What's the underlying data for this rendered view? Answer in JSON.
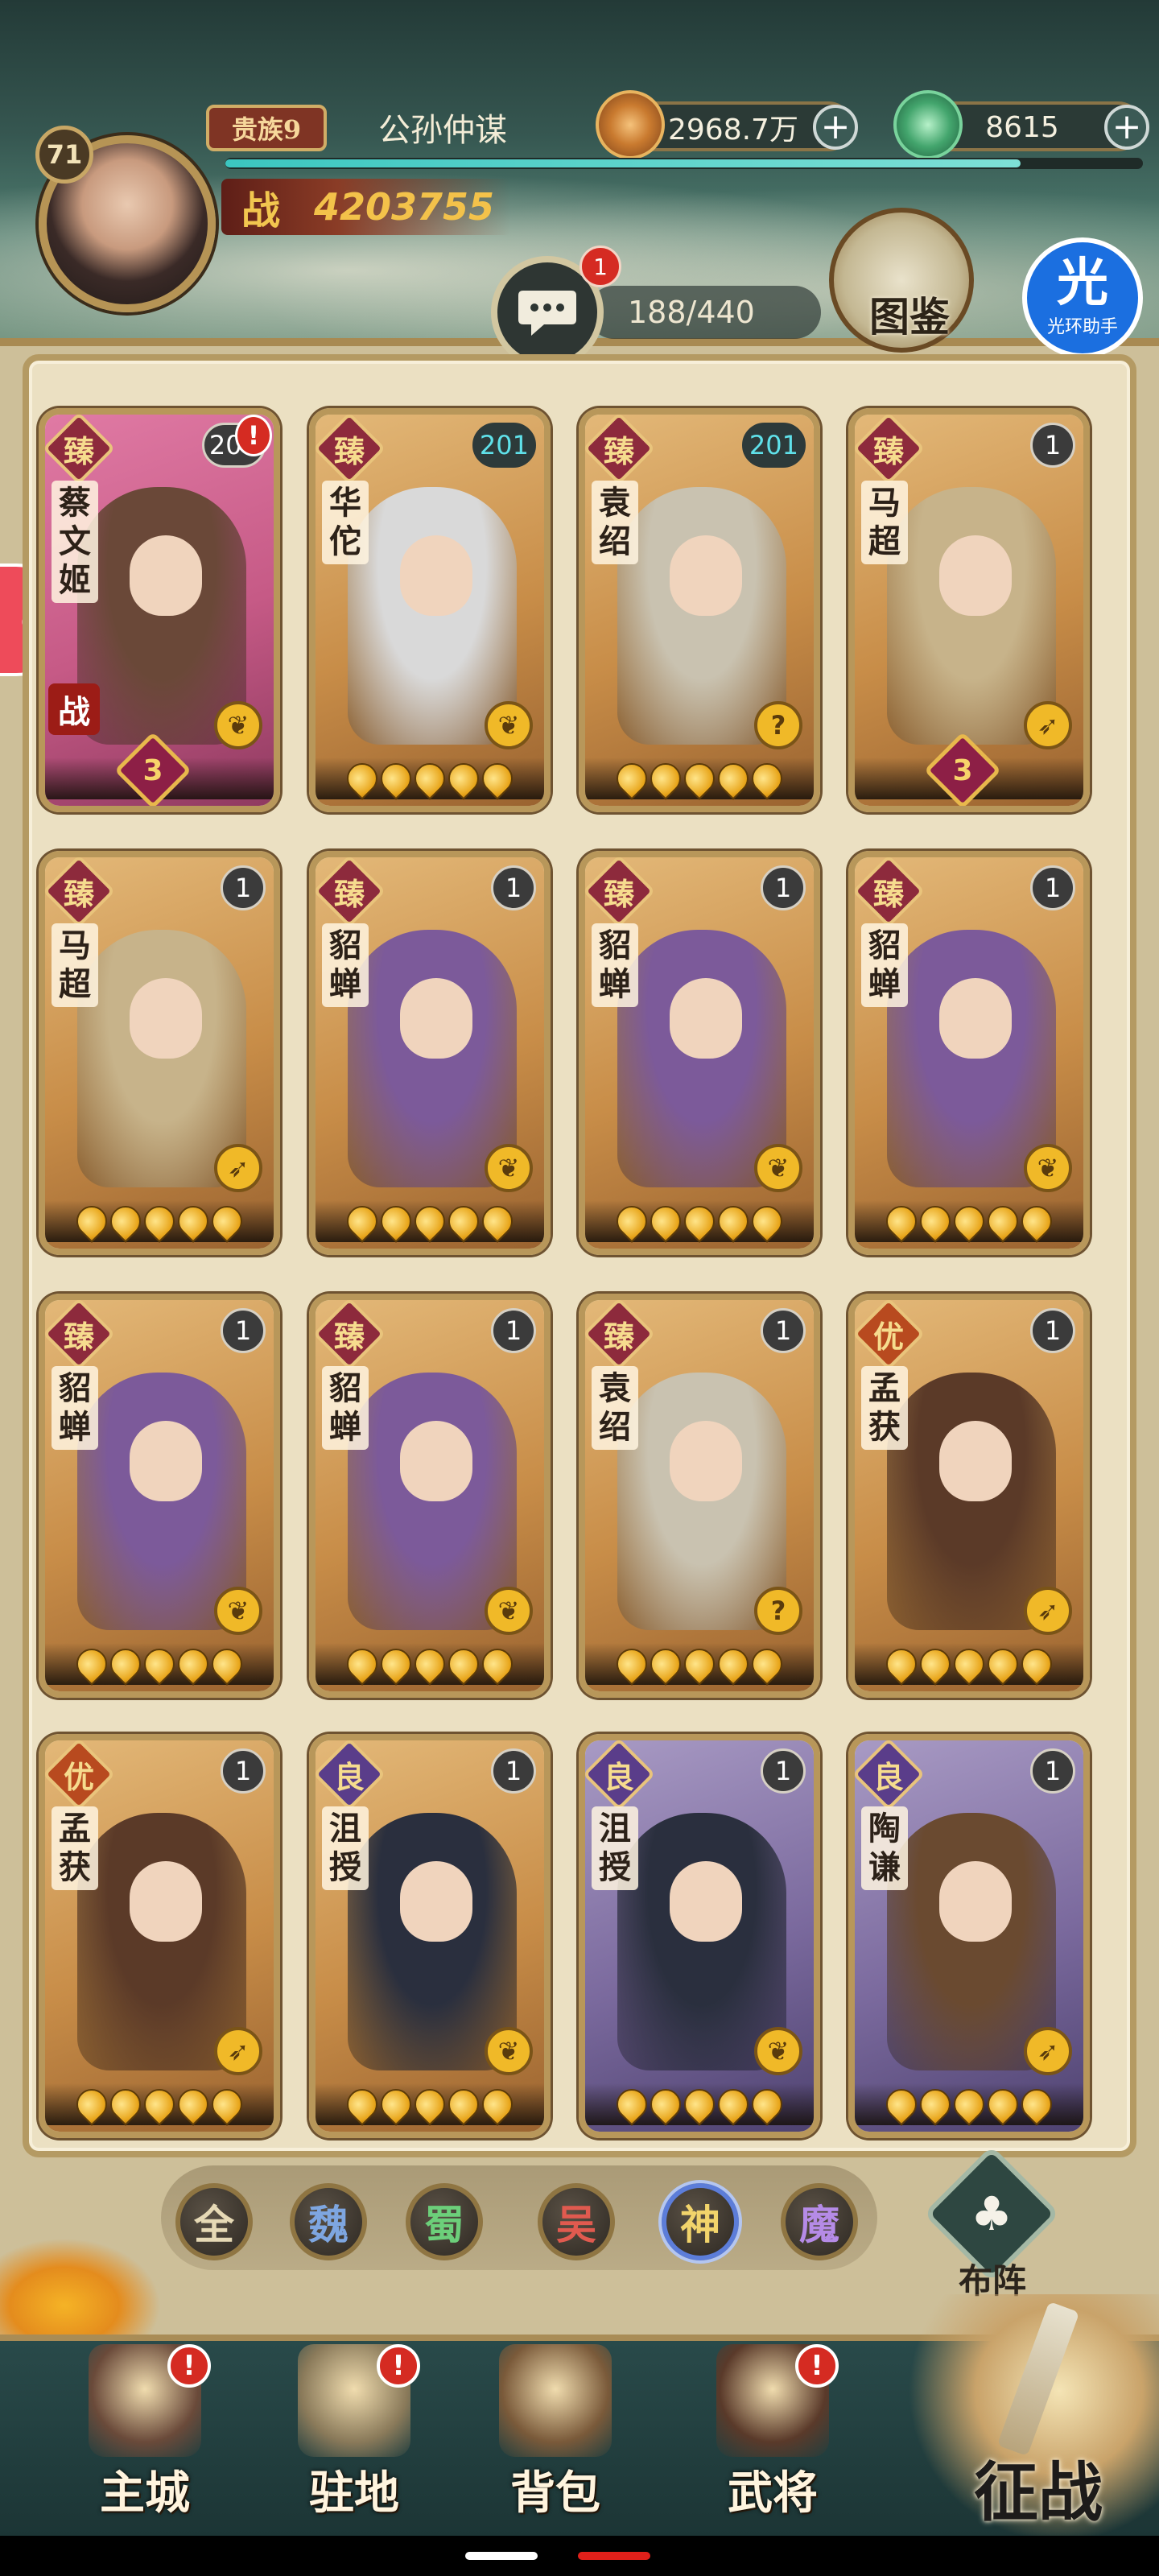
{
  "player": {
    "level": "71",
    "noble_rank": "贵族9",
    "name": "公孙仲谋",
    "power_label": "战",
    "power": "4203755",
    "exp_fraction": 0.87
  },
  "resources": {
    "coins": "2968.7万",
    "jade": "8615"
  },
  "chat": {
    "badge": "1"
  },
  "roster": {
    "capacity": "188/440"
  },
  "codex": {
    "label": "图鉴"
  },
  "helper": {
    "glyph": "光",
    "label": "光环助手"
  },
  "colors": {
    "grade_zhen": "#8d2a3c",
    "grade_you": "#b84a1f",
    "grade_liang": "#5a3d8a",
    "card_gold": "#c9964f",
    "card_pink": "#c65a86",
    "card_purple": "#7b6a9e",
    "accent_teal": "#5fe1ea"
  },
  "cards": [
    {
      "grade": "臻",
      "name": "蔡文姬",
      "level": "201",
      "level_style": "plain",
      "alert": "!",
      "class": "医",
      "stars": 0,
      "tier": "3",
      "battle": "战",
      "theme": "pink",
      "figure": "#6a4838"
    },
    {
      "grade": "臻",
      "name": "华佗",
      "level": "201",
      "level_style": "teal",
      "class": "辅",
      "stars": 5,
      "theme": "gold",
      "figure": "#d9d9d9"
    },
    {
      "grade": "臻",
      "name": "袁绍",
      "level": "201",
      "level_style": "teal",
      "class": "谋",
      "stars": 5,
      "theme": "gold",
      "figure": "#c9c2b0"
    },
    {
      "grade": "臻",
      "name": "马超",
      "level": "1",
      "level_style": "plain",
      "class": "弓",
      "stars": 0,
      "tier": "3",
      "theme": "gold",
      "figure": "#c7b38a"
    },
    {
      "grade": "臻",
      "name": "马超",
      "level": "1",
      "level_style": "plain",
      "class": "弓",
      "stars": 5,
      "theme": "gold",
      "figure": "#c7b38a"
    },
    {
      "grade": "臻",
      "name": "貂蝉",
      "level": "1",
      "level_style": "plain",
      "class": "辅",
      "stars": 5,
      "theme": "gold",
      "figure": "#7c5a9a"
    },
    {
      "grade": "臻",
      "name": "貂蝉",
      "level": "1",
      "level_style": "plain",
      "class": "辅",
      "stars": 5,
      "theme": "gold",
      "figure": "#7c5a9a"
    },
    {
      "grade": "臻",
      "name": "貂蝉",
      "level": "1",
      "level_style": "plain",
      "class": "辅",
      "stars": 5,
      "theme": "gold",
      "figure": "#7c5a9a"
    },
    {
      "grade": "臻",
      "name": "貂蝉",
      "level": "1",
      "level_style": "plain",
      "class": "辅",
      "stars": 5,
      "theme": "gold",
      "figure": "#7c5a9a"
    },
    {
      "grade": "臻",
      "name": "貂蝉",
      "level": "1",
      "level_style": "plain",
      "class": "辅",
      "stars": 5,
      "theme": "gold",
      "figure": "#7c5a9a"
    },
    {
      "grade": "臻",
      "name": "袁绍",
      "level": "1",
      "level_style": "plain",
      "class": "谋",
      "stars": 5,
      "theme": "gold",
      "figure": "#c9c2b0"
    },
    {
      "grade": "优",
      "name": "孟获",
      "level": "1",
      "level_style": "plain",
      "class": "弓",
      "stars": 5,
      "theme": "gold",
      "figure": "#5b3a28"
    },
    {
      "grade": "优",
      "name": "孟获",
      "level": "1",
      "level_style": "plain",
      "class": "弓",
      "stars": 5,
      "theme": "gold",
      "figure": "#5b3a28"
    },
    {
      "grade": "良",
      "name": "沮授",
      "level": "1",
      "level_style": "plain",
      "class": "辅",
      "stars": 5,
      "theme": "gold",
      "figure": "#2a2f3e"
    },
    {
      "grade": "良",
      "name": "沮授",
      "level": "1",
      "level_style": "plain",
      "class": "辅",
      "stars": 5,
      "theme": "purple",
      "figure": "#2a2f3e"
    },
    {
      "grade": "良",
      "name": "陶谦",
      "level": "1",
      "level_style": "plain",
      "class": "弓",
      "stars": 5,
      "theme": "purple",
      "figure": "#6a4a30"
    }
  ],
  "filters": [
    {
      "label": "全",
      "color": "#e6d9b5",
      "active": false
    },
    {
      "label": "魏",
      "color": "#7ea6e0",
      "active": false
    },
    {
      "label": "蜀",
      "color": "#6ccf7a",
      "active": false
    },
    {
      "label": "吴",
      "color": "#e05a4f",
      "active": false
    },
    {
      "label": "神",
      "color": "#f2d46b",
      "active": true
    },
    {
      "label": "魔",
      "color": "#b58be6",
      "active": false
    }
  ],
  "formation": {
    "label": "布阵"
  },
  "nav": [
    {
      "label": "主城",
      "alert": "!",
      "color": "#6a4a3a"
    },
    {
      "label": "驻地",
      "alert": "!",
      "color": "#8a7a5a"
    },
    {
      "label": "背包",
      "alert": "",
      "color": "#7a5a3a"
    },
    {
      "label": "武将",
      "alert": "!",
      "color": "#5a3a2a"
    }
  ],
  "campaign": {
    "label": "征战"
  }
}
